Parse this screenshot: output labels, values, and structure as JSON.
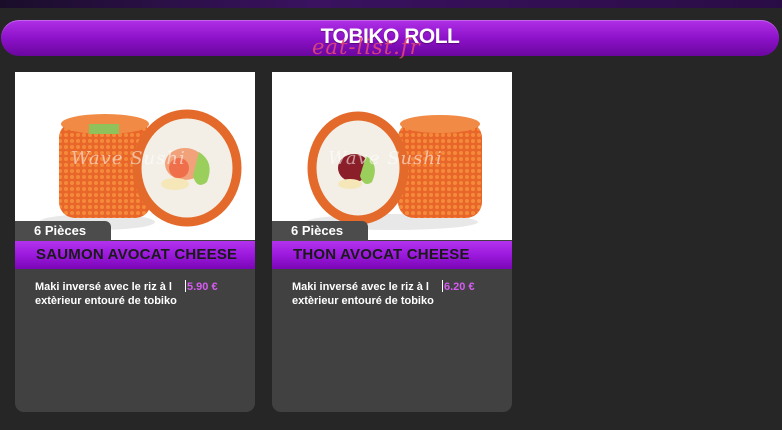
{
  "category": {
    "title": "TOBIKO ROLL",
    "watermark": "eat-list.fr"
  },
  "products": [
    {
      "pieces": "6 Pièces",
      "name": "SAUMON AVOCAT CHEESE",
      "description": "Maki inversé avec le riz à l extèrieur entouré de tobiko",
      "price": "5.90 €",
      "photo_watermark": "Wave Sushi",
      "filling": "salmon"
    },
    {
      "pieces": "6 Pièces",
      "name": "THON AVOCAT CHEESE",
      "description": "Maki inversé avec le riz à l extèrieur entouré de tobiko",
      "price": "6.20 €",
      "photo_watermark": "Wave Sushi",
      "filling": "tuna"
    }
  ],
  "colors": {
    "accent": "#8d12c9",
    "price": "#d45cf0",
    "background": "#262626",
    "card": "#414141"
  }
}
